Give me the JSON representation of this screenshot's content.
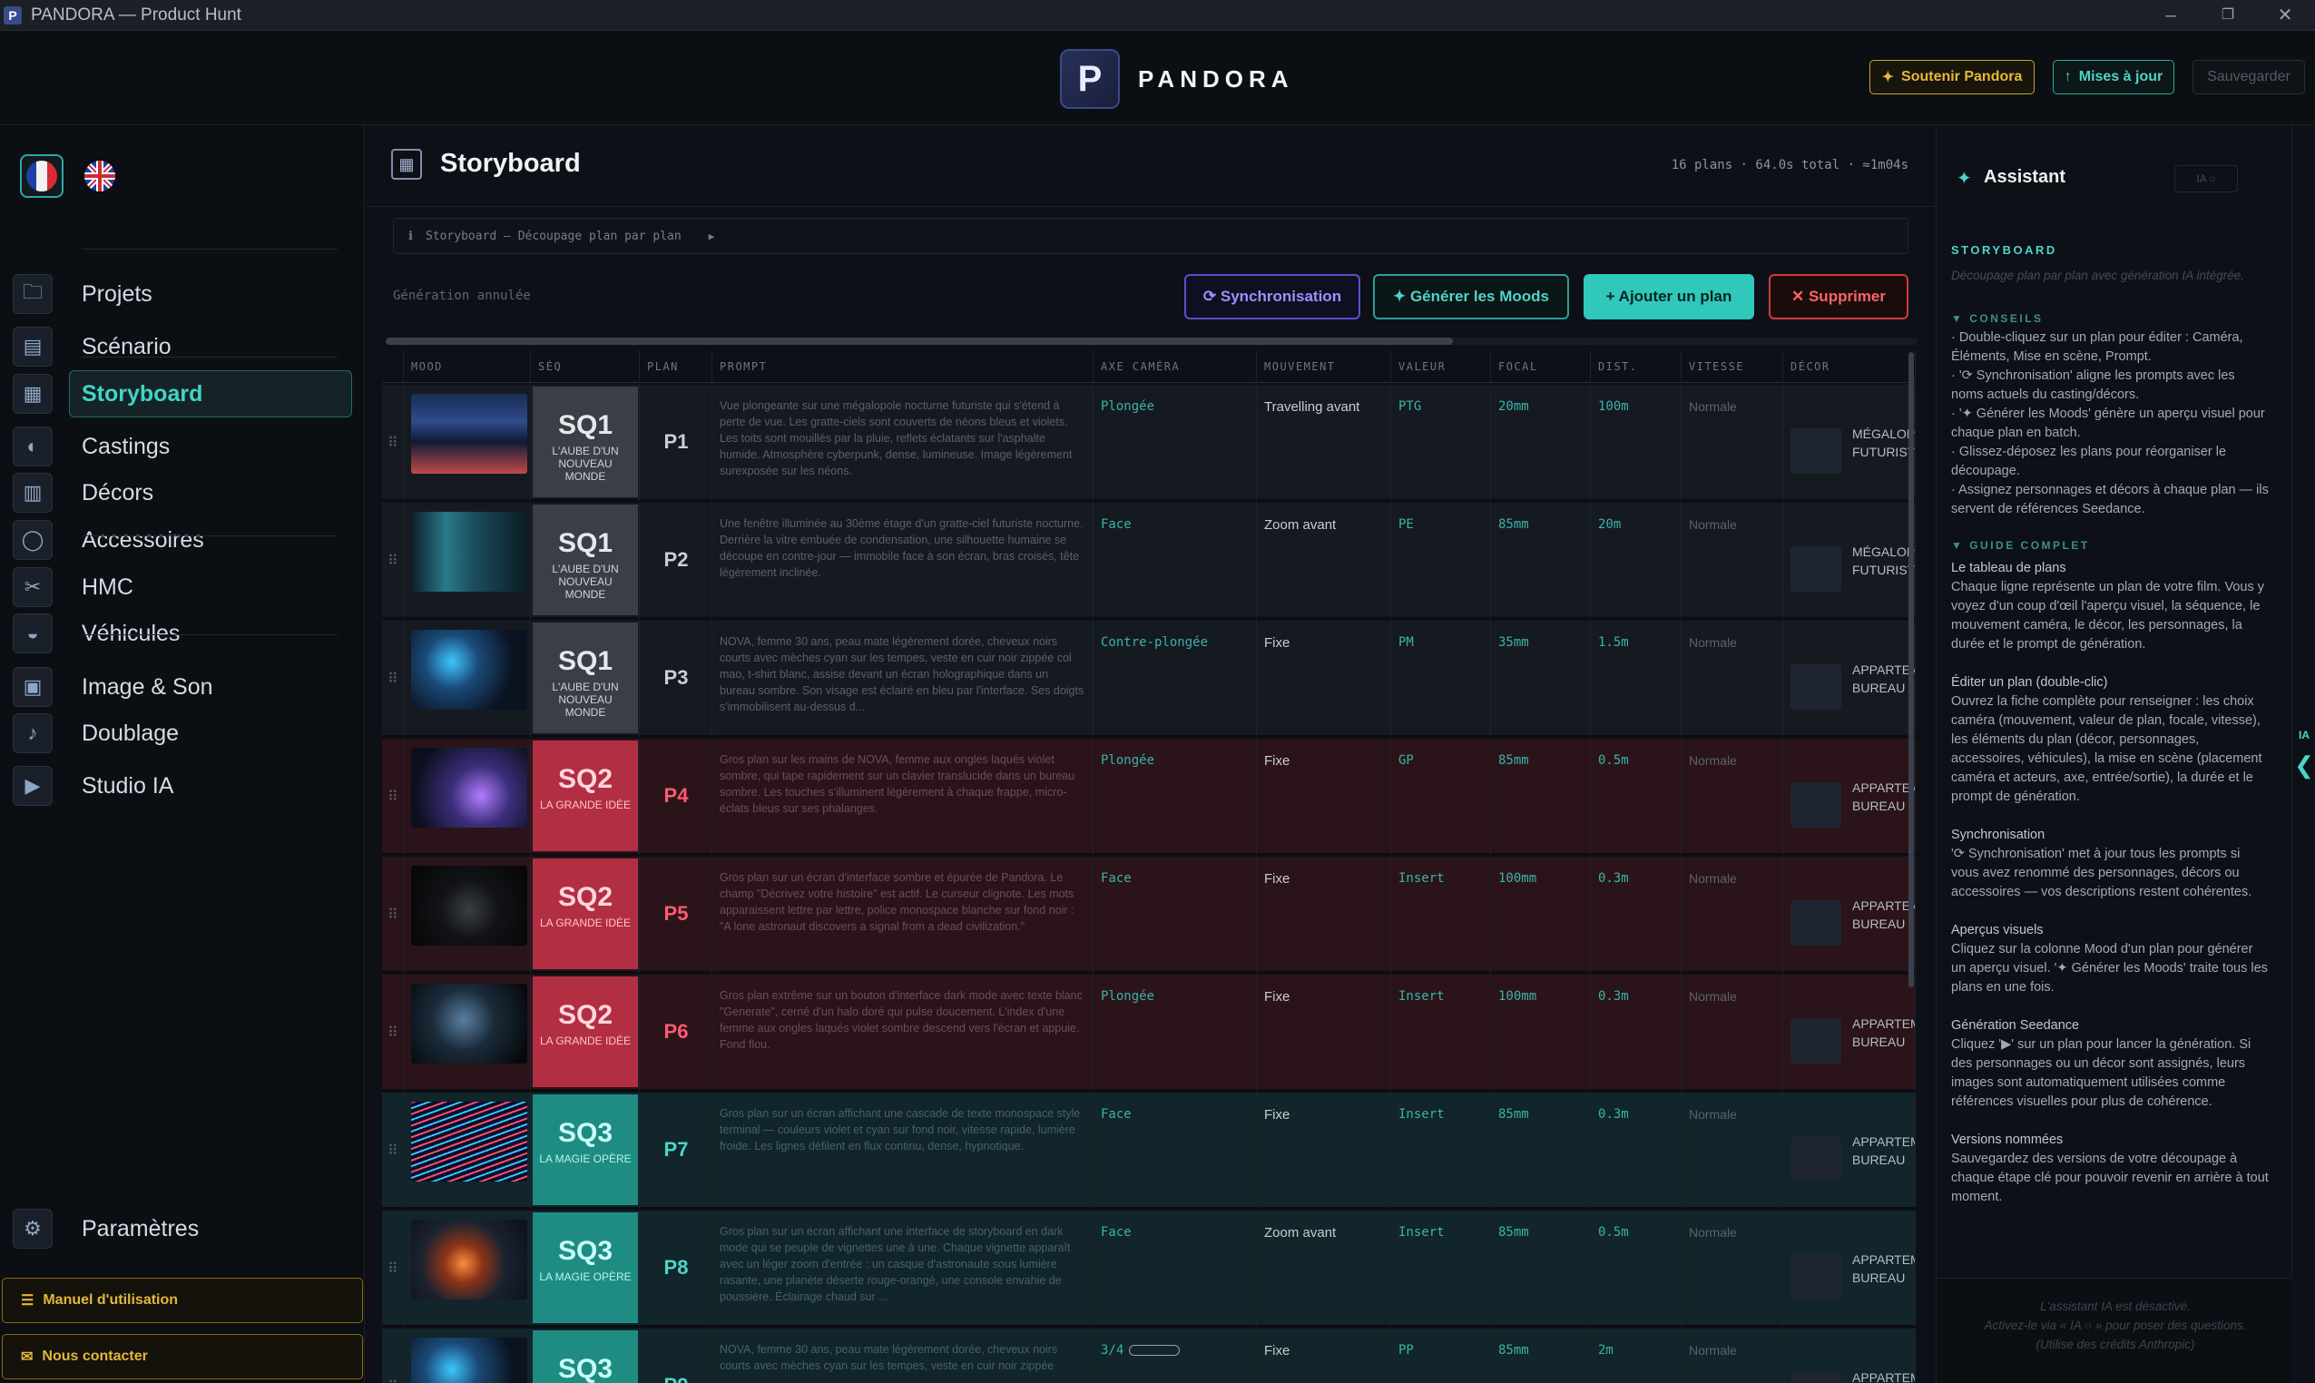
{
  "window": {
    "title": "PANDORA — Product Hunt",
    "controls": [
      "–",
      "❐",
      "✕"
    ]
  },
  "header": {
    "logo_letter": "P",
    "logo_text": "PANDORA",
    "btn_soutenir": "Soutenir Pandora",
    "btn_maj": "Mises à jour",
    "btn_save": "Sauvegarder"
  },
  "sidebar": {
    "nav": [
      {
        "id": "projets",
        "label": "Projets",
        "icon": "folder-icon"
      },
      {
        "id": "scenario",
        "label": "Scénario",
        "icon": "document-icon"
      },
      {
        "id": "storyboard",
        "label": "Storyboard",
        "icon": "storyboard-grid-icon",
        "active": true
      },
      {
        "id": "castings",
        "label": "Castings",
        "icon": "person-icon"
      },
      {
        "id": "decors",
        "label": "Décors",
        "icon": "building-icon"
      },
      {
        "id": "accessoires",
        "label": "Accessoires",
        "icon": "ring-icon"
      },
      {
        "id": "hmc",
        "label": "HMC",
        "icon": "makeup-icon"
      },
      {
        "id": "vehicules",
        "label": "Véhicules",
        "icon": "ufo-icon"
      },
      {
        "id": "image-son",
        "label": "Image & Son",
        "icon": "camera-icon"
      },
      {
        "id": "doublage",
        "label": "Doublage",
        "icon": "microphone-icon"
      },
      {
        "id": "studio-ia",
        "label": "Studio IA",
        "icon": "film-icon"
      }
    ],
    "settings_label": "Paramètres",
    "manual_label": "Manuel d'utilisation",
    "contact_label": "Nous contacter"
  },
  "main": {
    "title": "Storyboard",
    "stats": "16 plans  ·  64.0s total  ·  ≈1m04s",
    "breadcrumb": "Storyboard — Découpage plan par plan",
    "status": "Génération annulée",
    "btn_sync": "⟳ Synchronisation",
    "btn_moods": "✦ Générer les Moods",
    "btn_add": "+ Ajouter un plan",
    "btn_del": "✕ Supprimer",
    "columns": [
      "MOOD",
      "SÉQ",
      "PLAN",
      "PROMPT",
      "AXE CAMÉRA",
      "MOUVEMENT",
      "VALEUR",
      "FOCAL",
      "DIST.",
      "VITESSE",
      "DÉCOR"
    ],
    "rows": [
      {
        "seq": "SQ1",
        "seq_name": "L'AUBE D'UN NOUVEAU MONDE",
        "plan": "P1",
        "theme": "sq1",
        "prompt": "Vue plongeante sur une mégalopole nocturne futuriste qui s'étend à perte de vue. Les gratte-ciels sont couverts de néons bleus et violets. Les toits sont mouillés par la pluie, reflets éclatants sur l'asphalte humide. Atmosphère cyberpunk, dense, lumineuse. Image légèrement surexposée sur les néons.",
        "axe": "Plongée",
        "mouvement": "Travelling avant",
        "valeur": "PTG",
        "focal": "20mm",
        "dist": "100m",
        "vitesse": "Normale",
        "decor": "MÉGALOPOLE FUTURISTE",
        "img": "city"
      },
      {
        "seq": "SQ1",
        "seq_name": "L'AUBE D'UN NOUVEAU MONDE",
        "plan": "P2",
        "theme": "sq1",
        "prompt": "Une fenêtre illuminée au 30ème étage d'un gratte-ciel futuriste nocturne. Derrière la vitre embuée de condensation, une silhouette humaine se découpe en contre-jour — immobile face à son écran, bras croisés, tête légèrement inclinée.",
        "axe": "Face",
        "mouvement": "Zoom avant",
        "valeur": "PE",
        "focal": "85mm",
        "dist": "20m",
        "vitesse": "Normale",
        "decor": "MÉGALOPOLE FUTURISTE",
        "img": "window"
      },
      {
        "seq": "SQ1",
        "seq_name": "L'AUBE D'UN NOUVEAU MONDE",
        "plan": "P3",
        "theme": "sq1",
        "prompt": "NOVA, femme 30 ans, peau mate légèrement dorée, cheveux noirs courts avec mèches cyan sur les tempes, veste en cuir noir zippée col mao, t-shirt blanc, assise devant un écran holographique dans un bureau sombre. Son visage est éclairé en bleu par l'interface. Ses doigts s'immobilisent au-dessus d...",
        "axe": "Contre-plongée",
        "mouvement": "Fixe",
        "valeur": "PM",
        "focal": "35mm",
        "dist": "1.5m",
        "vitesse": "Normale",
        "decor": "APPARTEMENT BUREAU",
        "img": "nova"
      },
      {
        "seq": "SQ2",
        "seq_name": "LA GRANDE IDÉE",
        "plan": "P4",
        "theme": "sq2",
        "prompt": "Gros plan sur les mains de NOVA, femme aux ongles laqués violet sombre, qui tape rapidement sur un clavier translucide dans un bureau sombre. Les touches s'illuminent légèrement à chaque frappe, micro-éclats bleus sur ses phalanges.",
        "axe": "Plongée",
        "mouvement": "Fixe",
        "valeur": "GP",
        "focal": "85mm",
        "dist": "0.5m",
        "vitesse": "Normale",
        "decor": "APPARTEMENT BUREAU",
        "img": "hands"
      },
      {
        "seq": "SQ2",
        "seq_name": "LA GRANDE IDÉE",
        "plan": "P5",
        "theme": "sq2",
        "prompt": "Gros plan sur un écran d'interface sombre et épurée de Pandora. Le champ \"Décrivez votre histoire\" est actif. Le curseur clignote. Les mots apparaissent lettre par lettre, police monospace blanche sur fond noir : \"A lone astronaut discovers a signal from a dead civilization.\"",
        "axe": "Face",
        "mouvement": "Fixe",
        "valeur": "Insert",
        "focal": "100mm",
        "dist": "0.3m",
        "vitesse": "Normale",
        "decor": "APPARTEMENT BUREAU",
        "img": "screen"
      },
      {
        "seq": "SQ2",
        "seq_name": "LA GRANDE IDÉE",
        "plan": "P6",
        "theme": "sq2",
        "prompt": "Gros plan extrême sur un bouton d'interface dark mode avec texte blanc \"Generate\", cerné d'un halo doré qui pulse doucement. L'index d'une femme aux ongles laqués violet sombre descend vers l'écran et appuie. Fond flou.",
        "axe": "Plongée",
        "mouvement": "Fixe",
        "valeur": "Insert",
        "focal": "100mm",
        "dist": "0.3m",
        "vitesse": "Normale",
        "decor": "APPARTEMENT BUREAU",
        "img": "button"
      },
      {
        "seq": "SQ3",
        "seq_name": "LA MAGIE OPÈRE",
        "plan": "P7",
        "theme": "sq3",
        "prompt": "Gros plan sur un écran affichant une cascade de texte monospace style terminal — couleurs violet et cyan sur fond noir, vitesse rapide, lumière froide. Les lignes défilent en flux continu, dense, hypnotique.",
        "axe": "Face",
        "mouvement": "Fixe",
        "valeur": "Insert",
        "focal": "85mm",
        "dist": "0.3m",
        "vitesse": "Normale",
        "decor": "APPARTEMENT BUREAU",
        "img": "code"
      },
      {
        "seq": "SQ3",
        "seq_name": "LA MAGIE OPÈRE",
        "plan": "P8",
        "theme": "sq3",
        "prompt": "Gros plan sur un écran affichant une interface de storyboard en dark mode qui se peuple de vignettes une à une. Chaque vignette apparaît avec un léger zoom d'entrée : un casque d'astronaute sous lumière rasante, une planète déserte rouge-orangé, une console envahie de poussière. Éclairage chaud sur ...",
        "axe": "Face",
        "mouvement": "Zoom avant",
        "valeur": "Insert",
        "focal": "85mm",
        "dist": "0.5m",
        "vitesse": "Normale",
        "decor": "APPARTEMENT BUREAU",
        "img": "astro"
      },
      {
        "seq": "SQ3",
        "seq_name": "LA MAGIE OPÈRE",
        "plan": "P9",
        "theme": "sq3",
        "prompt": "NOVA, femme 30 ans, peau mate légèrement dorée, cheveux noirs courts avec mèches cyan sur les tempes, veste en cuir noir zippée",
        "axe": "3/4",
        "mouvement": "Fixe",
        "valeur": "PP",
        "focal": "85mm",
        "dist": "2m",
        "vitesse": "Normale",
        "decor": "APPARTEMENT BUREAU",
        "img": "nova"
      }
    ]
  },
  "assistant": {
    "title": "Assistant",
    "ia_badge": "IA ○",
    "section": "STORYBOARD",
    "subtitle": "Découpage plan par plan avec génération IA intégrée.",
    "conseils_h": "▼  CONSEILS",
    "conseils": [
      "· Double-cliquez sur un plan pour éditer : Caméra, Éléments, Mise en scène, Prompt.",
      "· '⟳ Synchronisation' aligne les prompts avec les noms actuels du casting/décors.",
      "· '✦ Générer les Moods' génère un aperçu visuel pour chaque plan en batch.",
      "· Glissez-déposez les plans pour réorganiser le découpage.",
      "· Assignez personnages et décors à chaque plan — ils servent de références Seedance."
    ],
    "guide_h": "▼  GUIDE COMPLET",
    "guide": [
      {
        "title": "Le tableau de plans",
        "body": "Chaque ligne représente un plan de votre film. Vous y voyez d'un coup d'œil l'aperçu visuel, la séquence, le mouvement caméra, le décor, les personnages, la durée et le prompt de génération."
      },
      {
        "title": "Éditer un plan (double-clic)",
        "body": "Ouvrez la fiche complète pour renseigner : les choix caméra (mouvement, valeur de plan, focale, vitesse), les éléments du plan (décor, personnages, accessoires, véhicules), la mise en scène (placement caméra et acteurs, axe, entrée/sortie), la durée et le prompt de génération."
      },
      {
        "title": "Synchronisation",
        "body": "'⟳ Synchronisation' met à jour tous les prompts si vous avez renommé des personnages, décors ou accessoires — vos descriptions restent cohérentes."
      },
      {
        "title": "Aperçus visuels",
        "body": "Cliquez sur la colonne Mood d'un plan pour générer un aperçu visuel. '✦ Générer les Moods' traite tous les plans en une fois."
      },
      {
        "title": "Génération Seedance",
        "body": "Cliquez '▶' sur un plan pour lancer la génération. Si des personnages ou un décor sont assignés, leurs images sont automatiquement utilisées comme références visuelles pour plus de cohérence."
      },
      {
        "title": "Versions nommées",
        "body": "Sauvegardez des versions de votre découpage à chaque étape clé pour pouvoir revenir en arrière à tout moment."
      }
    ],
    "footer": "L'assistant IA est désactivé.\nActivez-le via « IA ○ » pour poser des questions.\n(Utilise des crédits Anthropic)",
    "toggle_label": "IA",
    "toggle_chevron": "❮"
  },
  "colors": {
    "accent": "#2fc8bb",
    "sq1": "#3a3f47",
    "sq2": "#b22e43",
    "sq3": "#1e8c83",
    "gold": "#e4b83a",
    "danger": "#ff6363",
    "violet": "#5a4fd0"
  }
}
